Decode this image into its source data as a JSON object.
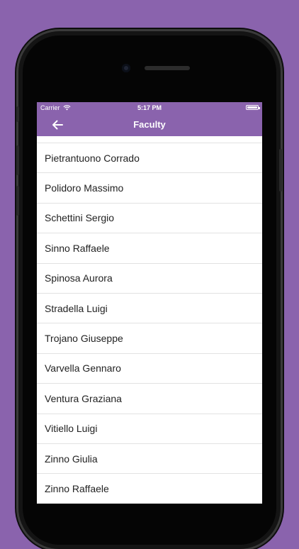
{
  "status_bar": {
    "carrier": "Carrier",
    "time": "5:17 PM",
    "wifi_icon": "wifi-icon",
    "battery_icon": "battery-icon"
  },
  "nav_bar": {
    "title": "Faculty",
    "back_icon": "arrow-left-icon"
  },
  "faculty": [
    "Pietrantuono Corrado",
    "Polidoro Massimo",
    "Schettini Sergio",
    "Sinno Raffaele",
    "Spinosa Aurora",
    "Stradella Luigi",
    "Trojano Giuseppe",
    "Varvella Gennaro",
    "Ventura Graziana",
    "Vitiello Luigi",
    "Zinno Giulia",
    "Zinno Raffaele"
  ],
  "colors": {
    "background": "#8a63ad",
    "header": "#8a63ad",
    "list_background": "#ffffff",
    "separator": "#e2e2e2"
  }
}
